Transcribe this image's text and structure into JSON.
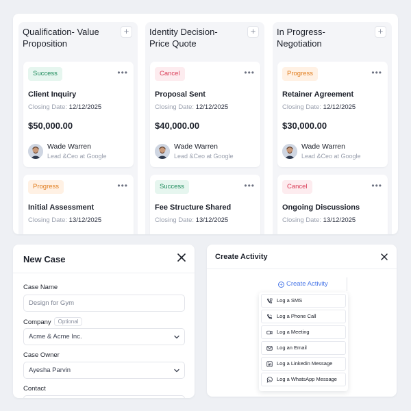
{
  "board": {
    "columns": [
      {
        "title": "Qualification- Value\nProposition",
        "cards": [
          {
            "status": "Success",
            "status_kind": "success",
            "name": "Client Inquiry",
            "closing_label": "Closing Date:",
            "closing_date": "12/12/2025",
            "amount": "$50,000.00",
            "person": "Wade Warren",
            "role": "Lead &Ceo at Google"
          },
          {
            "status": "Progress",
            "status_kind": "progress",
            "name": "Initial Assessment",
            "closing_label": "Closing Date:",
            "closing_date": "13/12/2025"
          }
        ]
      },
      {
        "title": "Identity Decision-\nPrice Quote",
        "cards": [
          {
            "status": "Cancel",
            "status_kind": "cancel",
            "name": "Proposal Sent",
            "closing_label": "Closing Date:",
            "closing_date": "12/12/2025",
            "amount": "$40,000.00",
            "person": "Wade Warren",
            "role": "Lead &Ceo at Google"
          },
          {
            "status": "Success",
            "status_kind": "success",
            "name": "Fee Structure Shared",
            "closing_label": "Closing Date:",
            "closing_date": "13/12/2025"
          }
        ]
      },
      {
        "title": "In Progress-\nNegotiation",
        "cards": [
          {
            "status": "Progress",
            "status_kind": "progress",
            "name": "Retainer Agreement",
            "closing_label": "Closing Date:",
            "closing_date": "12/12/2025",
            "amount": "$30,000.00",
            "person": "Wade Warren",
            "role": "Lead &Ceo at Google"
          },
          {
            "status": "Cancel",
            "status_kind": "cancel",
            "name": "Ongoing Discussions",
            "closing_label": "Closing Date:",
            "closing_date": "13/12/2025"
          }
        ]
      }
    ]
  },
  "new_case": {
    "title": "New Case",
    "case_name_label": "Case Name",
    "case_name_placeholder": "Design for Gym",
    "company_label": "Company",
    "optional_tag": "Optional",
    "company_value": "Acme & Acme Inc.",
    "owner_label": "Case Owner",
    "owner_value": "Ayesha Parvin",
    "contact_label": "Contact"
  },
  "activity": {
    "title": "Create Activity",
    "trigger_label": "Create Activity",
    "items": [
      {
        "label": "Log a SMS",
        "icon": "phone-chat-icon"
      },
      {
        "label": "Log a Phone Call",
        "icon": "phone-icon"
      },
      {
        "label": "Log a Meeting",
        "icon": "video-icon"
      },
      {
        "label": "Log an Email",
        "icon": "mail-icon"
      },
      {
        "label": "Log a Linkedin Message",
        "icon": "linkedin-icon"
      },
      {
        "label": "Log a WhatsApp Message",
        "icon": "whatsapp-icon"
      }
    ]
  },
  "colors": {
    "success": "#1b8a5a",
    "cancel": "#d93a55",
    "progress": "#e07c1c",
    "accent": "#4a78e8"
  }
}
